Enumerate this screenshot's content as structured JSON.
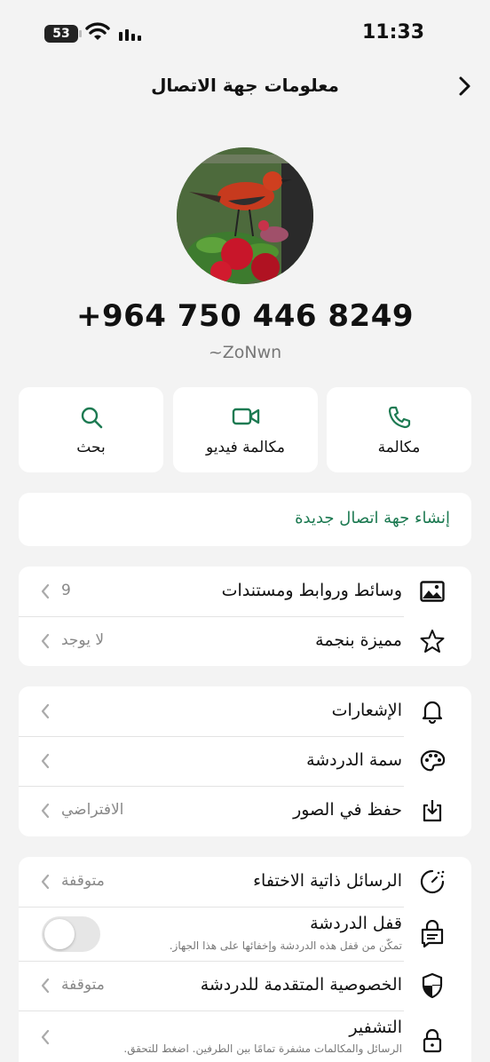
{
  "status_bar": {
    "time": "11:33",
    "battery_level": "53"
  },
  "header": {
    "title": "معلومات جهة الاتصال"
  },
  "profile": {
    "phone": "+964 750 446 8249",
    "username": "~ZoNwn"
  },
  "actions": [
    {
      "label": "بحث",
      "icon": "search-icon"
    },
    {
      "label": "مكالمة فيديو",
      "icon": "video-icon"
    },
    {
      "label": "مكالمة",
      "icon": "phone-icon"
    }
  ],
  "new_contact_label": "إنشاء جهة اتصال جديدة",
  "media_section": {
    "media": {
      "label": "وسائط وروابط ومستندات",
      "value": "9"
    },
    "starred": {
      "label": "مميزة بنجمة",
      "value": "لا يوجد"
    }
  },
  "settings_section": {
    "notifications": {
      "label": "الإشعارات"
    },
    "theme": {
      "label": "سمة الدردشة"
    },
    "save_photos": {
      "label": "حفظ في الصور",
      "value": "الافتراضي"
    }
  },
  "privacy_section": {
    "disappearing": {
      "label": "الرسائل ذاتية الاختفاء",
      "value": "متوقفة"
    },
    "chat_lock": {
      "label": "قفل الدردشة",
      "sub": "تمكّن من قفل هذه الدردشة وإخفائها على هذا الجهاز.",
      "toggle_on": false
    },
    "advanced_privacy": {
      "label": "الخصوصية المتقدمة للدردشة",
      "value": "متوقفة"
    },
    "encryption": {
      "label": "التشفير",
      "sub": "الرسائل والمكالمات مشفرة تمامًا بين الطرفين. اضغط للتحقق."
    }
  },
  "colors": {
    "accent": "#1d7a52",
    "background": "#f3f3f3",
    "card": "#ffffff"
  }
}
